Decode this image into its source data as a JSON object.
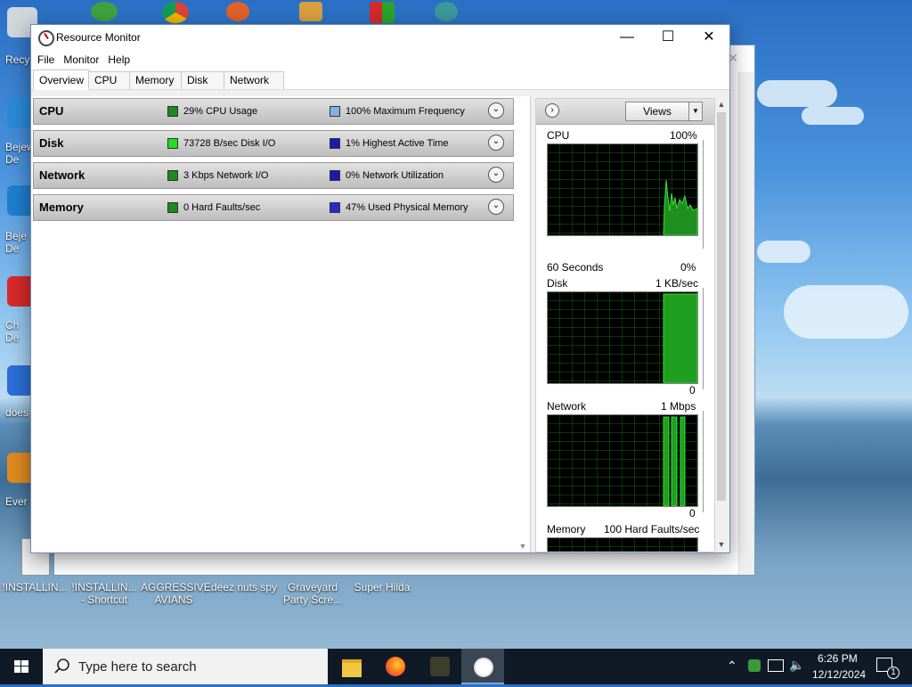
{
  "window": {
    "title": "Resource Monitor",
    "controls": {
      "minimize": "—",
      "maximize": "☐",
      "close": "✕"
    }
  },
  "menu": [
    "File",
    "Monitor",
    "Help"
  ],
  "tabs": [
    "Overview",
    "CPU",
    "Memory",
    "Disk",
    "Network"
  ],
  "sections": [
    {
      "name": "CPU",
      "stat1": "29% CPU Usage",
      "color1": "#1c8a1c",
      "stat2": "100% Maximum Frequency",
      "color2": "#7fb3e6"
    },
    {
      "name": "Disk",
      "stat1": "73728 B/sec Disk I/O",
      "color1": "#22dd22",
      "stat2": "1% Highest Active Time",
      "color2": "#1a1ab0"
    },
    {
      "name": "Network",
      "stat1": "3 Kbps Network I/O",
      "color1": "#1c8a1c",
      "stat2": "0% Network Utilization",
      "color2": "#1a1ab0"
    },
    {
      "name": "Memory",
      "stat1": "0 Hard Faults/sec",
      "color1": "#1c8a1c",
      "stat2": "47% Used Physical Memory",
      "color2": "#2a2acc"
    }
  ],
  "graphs": {
    "views_label": "Views",
    "cpu": {
      "label": "CPU",
      "max": "100%",
      "footer_left": "60 Seconds",
      "footer_right": "0%"
    },
    "disk": {
      "label": "Disk",
      "max": "1 KB/sec",
      "footer_right": "0"
    },
    "network": {
      "label": "Network",
      "max": "1 Mbps",
      "footer_right": "0"
    },
    "memory": {
      "label": "Memory",
      "max": "100 Hard Faults/sec"
    }
  },
  "desktop": {
    "left_labels": [
      "Recy",
      "Bejew\nDe",
      "Beje\nDe",
      "Ch\nDe",
      "does",
      "Ever"
    ],
    "bottom_icons": [
      "!INSTALLIN...",
      "!INSTALLIN...\n- Shortcut",
      "AGGRESSIVE\nAVIANS",
      "deez nuts spy",
      "Graveyard\nParty Scre...",
      "Super Hilda"
    ]
  },
  "taskbar": {
    "search_placeholder": "Type here to search",
    "time": "6:26 PM",
    "date": "12/12/2024",
    "notification_count": "1"
  }
}
